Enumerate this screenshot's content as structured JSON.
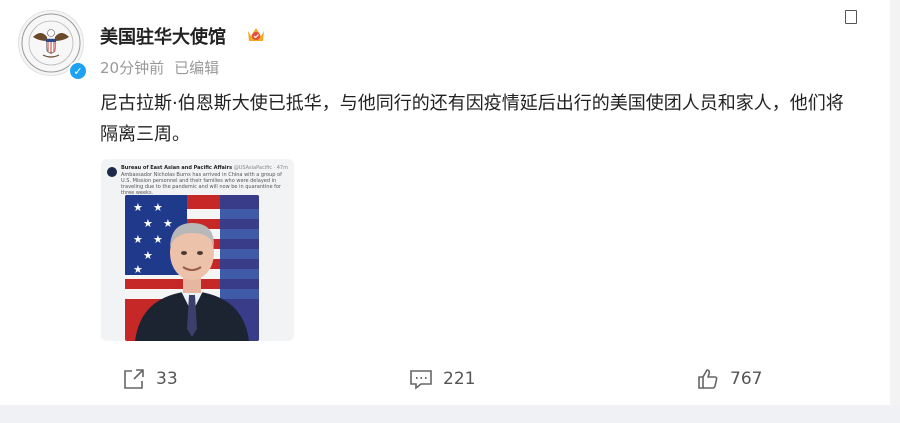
{
  "post": {
    "author": "美国驻华大使馆",
    "time": "20分钟前",
    "edited": "已编辑",
    "text": "尼古拉斯·伯恩斯大使已抵华，与他同行的还有因疫情延后出行的美国使团人员和家人，他们将隔离三周。"
  },
  "embed": {
    "account": "Bureau of East Asian and Pacific Affairs",
    "handle": "@USAsiaPacific · 47m",
    "body": "Ambassador Nicholas Burns has arrived in China with a group of U.S. Mission personnel and their families who were delayed in traveling due to the pandemic and will now be in quarantine for three weeks."
  },
  "actions": {
    "share_count": "33",
    "comment_count": "221",
    "like_count": "767"
  },
  "icons": [
    "embassy-seal-icon",
    "verified-icon",
    "vip-crown-icon",
    "more-icon",
    "share-icon",
    "comment-icon",
    "like-icon"
  ],
  "colors": {
    "verified": "#1da1f2",
    "text": "#222222",
    "meta": "#999999",
    "vip": "#f5a623"
  }
}
